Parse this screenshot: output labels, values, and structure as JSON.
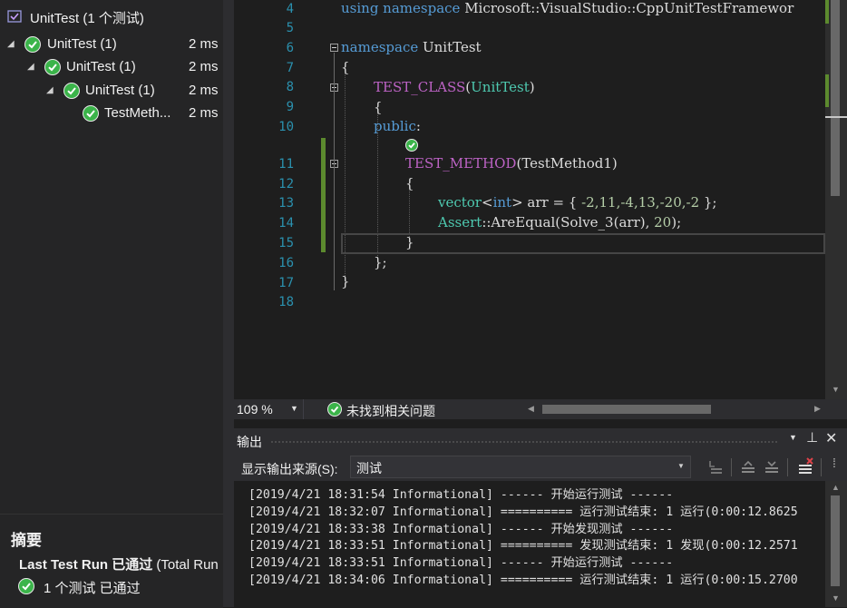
{
  "test_explorer": {
    "title": "UnitTest (1 个测试)",
    "tree": [
      {
        "label": "UnitTest (1)",
        "duration": "2 ms"
      },
      {
        "label": "UnitTest (1)",
        "duration": "2 ms"
      },
      {
        "label": "UnitTest (1)",
        "duration": "2 ms"
      },
      {
        "label": "TestMeth...",
        "duration": "2 ms"
      }
    ],
    "summary": {
      "heading": "摘要",
      "last_run_bold": "Last Test Run 已通过",
      "last_run_rest": " (Total Run",
      "passed": "1 个测试 已通过"
    }
  },
  "editor": {
    "lines": {
      "l4": "4",
      "l5": "5",
      "l6": "6",
      "l7": "7",
      "l8": "8",
      "l9": "9",
      "l10": "10",
      "l11": "11",
      "l12": "12",
      "l13": "13",
      "l14": "14",
      "l15": "15",
      "l16": "16",
      "l17": "17",
      "l18": "18"
    },
    "code": {
      "c4_kw": "using namespace",
      "c4_rest": " Microsoft::VisualStudio::CppUnitTestFramewor",
      "c6_kw": "namespace",
      "c6_rest": " UnitTest",
      "c7": "{",
      "c8_macro": "TEST_CLASS",
      "c8_open": "(",
      "c8_type": "UnitTest",
      "c8_close": ")",
      "c9": "{",
      "c10_kw": "public",
      "c10_rest": ":",
      "c11_macro": "TEST_METHOD",
      "c11_rest": "(TestMethod1)",
      "c12": "{",
      "c13_a": "vector",
      "c13_b": "<",
      "c13_kw": "int",
      "c13_c": "> arr = { ",
      "c13_nums": "-2,11,-4,13,-20,-2",
      "c13_d": " };",
      "c14_type": "Assert",
      "c14_rest": "::AreEqual(Solve_3(arr), ",
      "c14_num": "20",
      "c14_end": ");",
      "c15": "}",
      "c16": "};",
      "c17": "}"
    },
    "zoom": "109 %",
    "issues": "未找到相关问题"
  },
  "output": {
    "title": "输出",
    "source_label": "显示输出来源(S):",
    "source_value": "测试",
    "lines": [
      "[2019/4/21 18:31:54 Informational] ------ 开始运行测试 ------",
      "[2019/4/21 18:32:07 Informational] ========== 运行测试结束: 1 运行(0:00:12.8625",
      "[2019/4/21 18:33:38 Informational] ------ 开始发现测试 ------",
      "[2019/4/21 18:33:51 Informational] ========== 发现测试结束: 1 发现(0:00:12.2571",
      "[2019/4/21 18:33:51 Informational] ------ 开始运行测试 ------",
      "[2019/4/21 18:34:06 Informational] ========== 运行测试结束: 1 运行(0:00:15.2700"
    ]
  },
  "colors": {
    "pass_green": "#3bb44a",
    "keyword": "#569cd6",
    "macro": "#bd63c5",
    "type": "#4ec9b0",
    "number": "#b5cea8",
    "line_number": "#2b91af"
  }
}
